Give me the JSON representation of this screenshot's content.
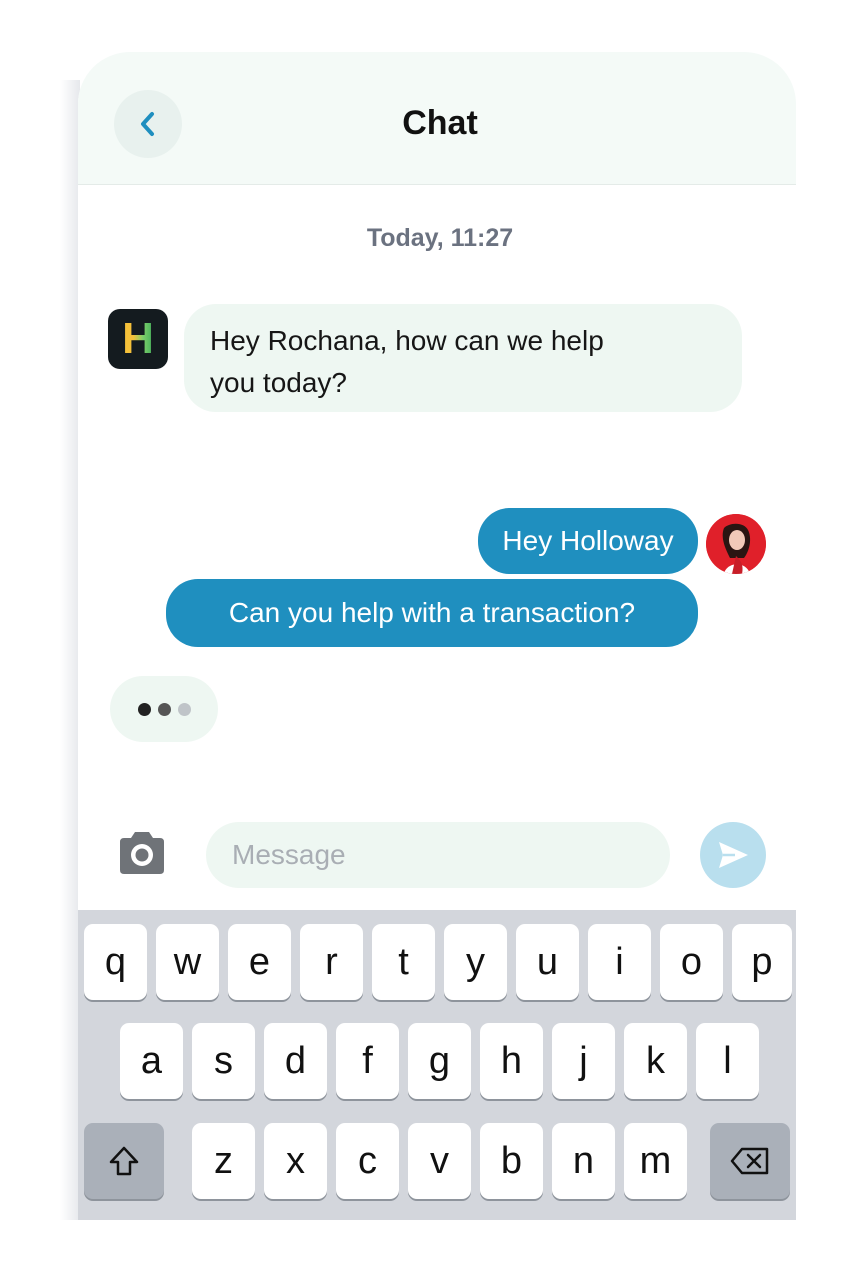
{
  "header": {
    "title": "Chat",
    "back_icon": "chevron-left-icon"
  },
  "conversation": {
    "timestamp": "Today, 11:27",
    "bot_avatar_letter": "H",
    "bot_message_lines": [
      "Hey Rochana, how can we help",
      "you today?"
    ],
    "user_messages": [
      "Hey Holloway",
      "Can you help with a transaction?"
    ],
    "typing_indicator": true
  },
  "composer": {
    "camera_icon": "camera-icon",
    "placeholder": "Message",
    "send_icon": "send-icon"
  },
  "keyboard": {
    "row1": [
      "q",
      "w",
      "e",
      "r",
      "t",
      "y",
      "u",
      "i",
      "o",
      "p"
    ],
    "row2": [
      "a",
      "s",
      "d",
      "f",
      "g",
      "h",
      "j",
      "k",
      "l"
    ],
    "row3": [
      "z",
      "x",
      "c",
      "v",
      "b",
      "n",
      "m"
    ],
    "shift_icon": "shift-icon",
    "backspace_icon": "backspace-icon"
  },
  "colors": {
    "accent": "#1f8fbf",
    "bubble_light": "#eef7f2",
    "header_bg": "#f4faf7",
    "keyboard_bg": "#d3d6dc"
  }
}
